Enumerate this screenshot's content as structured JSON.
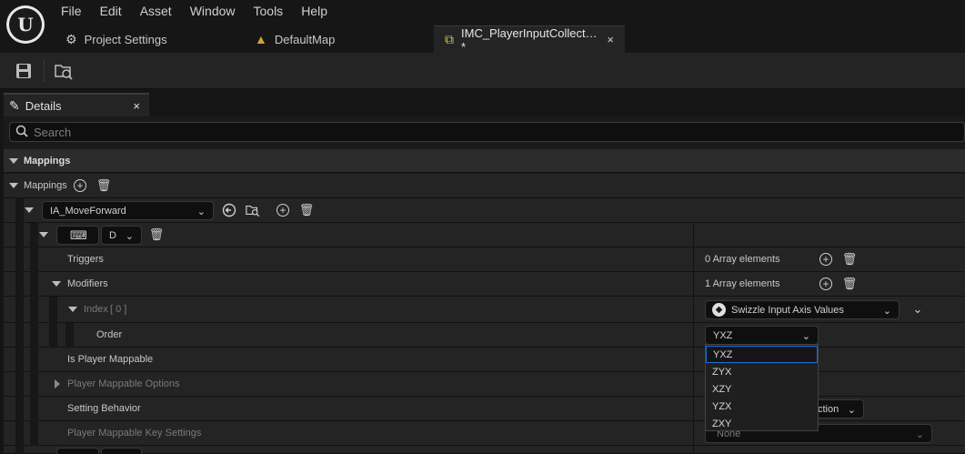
{
  "menu": [
    "File",
    "Edit",
    "Asset",
    "Window",
    "Tools",
    "Help"
  ],
  "tabs": [
    {
      "label": "Project Settings",
      "icon": "gear-icon"
    },
    {
      "label": "DefaultMap",
      "icon": "level-icon"
    },
    {
      "label": "IMC_PlayerInputCollect…*",
      "icon": "input-context-icon",
      "close": "×"
    }
  ],
  "details": {
    "tab_label": "Details",
    "tab_close": "×",
    "search_placeholder": "Search"
  },
  "mappings_category": "Mappings",
  "mappings_array": "Mappings",
  "input_action": "IA_MoveForward",
  "key_value": "D",
  "rows": {
    "triggers": {
      "label": "Triggers",
      "value": "0 Array elements"
    },
    "modifiers": {
      "label": "Modifiers",
      "value": "1 Array elements"
    },
    "index0": {
      "label": "Index",
      "index_text": "[ 0 ]",
      "value": "Swizzle Input Axis Values"
    },
    "order": {
      "label": "Order",
      "value": "YXZ"
    },
    "mappable": {
      "label": "Is Player Mappable"
    },
    "mappable_options": {
      "label": "Player Mappable Options"
    },
    "setting_behavior": {
      "label": "Setting Behavior",
      "value": "ction"
    },
    "key_settings": {
      "label": "Player Mappable Key Settings",
      "value": "None"
    }
  },
  "order_options": [
    "YXZ",
    "ZYX",
    "XZY",
    "YZX",
    "ZXY"
  ],
  "colors": {
    "selection": "#1d6fd6",
    "bg": "#151515",
    "row": "#242424"
  }
}
